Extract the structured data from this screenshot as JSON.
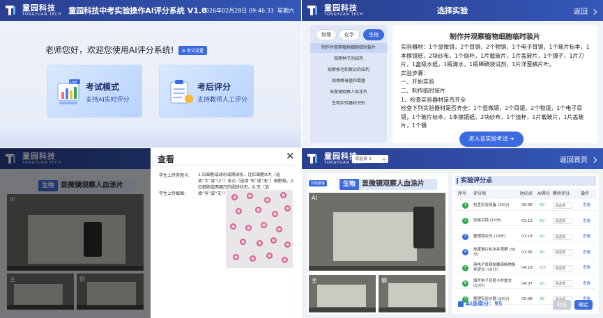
{
  "app": {
    "logo_cn": "童园科技",
    "logo_en": "TONGYUAN TECH",
    "title": "童园科技中考实验操作AI评分系统 V1.0",
    "datetime": "2026年02月28日 09:46:33",
    "weekday": "星期六"
  },
  "home": {
    "welcome": "老师您好，欢迎您使用AI评分系统!",
    "exam_settings": "考试设置",
    "cards": [
      {
        "title": "考试模式",
        "subtitle": "支持AI实时评分",
        "badge": "LIVE"
      },
      {
        "title": "考后评分",
        "subtitle": "支持教师人工评分"
      }
    ]
  },
  "select": {
    "title": "选择实验",
    "back": "返回",
    "subjects": [
      {
        "label": "物理",
        "active": false
      },
      {
        "label": "化学",
        "active": false
      },
      {
        "label": "生物",
        "active": true
      }
    ],
    "experiments": [
      {
        "label": "制作并观察植物细胞临时装片",
        "active": true
      },
      {
        "label": "观察种子的结构",
        "active": false
      },
      {
        "label": "观察根毛和根尖的结构",
        "active": false
      },
      {
        "label": "观察酵母菌和霉菌",
        "active": false
      },
      {
        "label": "显微镜观察人血涂片",
        "active": false
      },
      {
        "label": "生物实验器材识别",
        "active": false
      }
    ],
    "detail_title": "制作并观察植物细胞临时装片",
    "detail_lines": [
      "实验器材：1个显微镜，2个目镜，2个物镜，1个电子目镜，1个玻片标本，1本擦镜纸，2块纱布，1个烧杯，1片载玻片，1片盖玻片，1个镊子，1片刀片，1盒吸水纸，1瓶清水，1瓶稀碘液试剂，1片洋葱鳞片叶。",
      "实验步骤：",
      "一、开始实验",
      "二、制作临时装片",
      "1、检查实验器材是否齐全",
      "检查下列实验器材是否齐全：1个显微镜，2个目镜，2个物镜，1个电子目镜，1个玻片标本，1本擦镜纸，2块纱布，1个烧杯，1片载玻片，1片盖玻片，1个镊"
    ],
    "enter_button": "进入该实验考试"
  },
  "review": {
    "subject": "生物",
    "experiment": "显微镜观察人血涂片",
    "cam_main": "主",
    "cam_side": "侧",
    "cam_ai": "AI",
    "modal_title": "查看",
    "answer_label": "学生上传答题卡:",
    "answer_text": "1.白细胞或球形或椭球形、比红细胞A大（选填“大”或“小”）本点（选填“有”或“无”）细胞核。2.红细胞或两面凹的圆饼状形。B.无（选填“有”或“无”）细胞核。",
    "photo_label": "学生上传截图:"
  },
  "scoring": {
    "select_value": "请选择 3",
    "back_home": "返回首页",
    "subject": "生物",
    "experiment": "显微镜观察人血涂片",
    "start_button": "开始录像",
    "cam_main": "主",
    "cam_side": "侧",
    "cam_ai": "AI",
    "panel_title": "实验评分点",
    "headers": [
      "序号",
      "评分项",
      "时间点",
      "AI得分",
      "教师评分",
      "操作"
    ],
    "rows": [
      {
        "no": "1",
        "item": "检查实验设备 (10分)",
        "time": "00:06",
        "ai": "10",
        "teacher": "请选择",
        "op": "查看"
      },
      {
        "no": "2",
        "item": "安装目镜 (10分)",
        "time": "01:12",
        "ai": "10",
        "teacher": "请选择",
        "op": "查看"
      },
      {
        "no": "3",
        "item": "整理镜对光 (10分)",
        "time": "01:18",
        "ai": "10",
        "teacher": "请选择",
        "op": "查看"
      },
      {
        "no": "4",
        "item": "放置玻片标本并观察 (30分)",
        "time": "01:36",
        "ai": "30",
        "teacher": "请选择",
        "op": "查看"
      },
      {
        "no": "5",
        "item": "用电子目镜拍摄清晰物象并提交 (10分)",
        "time": "04:18",
        "ai": "5.0",
        "teacher": "请选择",
        "op": "查看"
      },
      {
        "no": "6",
        "item": "填写电子答题卡并提交 (10分)",
        "time": "04:37",
        "ai": "10",
        "teacher": "请选择",
        "op": "查看"
      },
      {
        "no": "7",
        "item": "整理实验仪器 (20分)",
        "time": "05:08",
        "ai": "20",
        "teacher": "请选择",
        "op": "查看"
      }
    ],
    "total": "AI总得分：95",
    "cancel": "取消",
    "confirm": "确定"
  }
}
